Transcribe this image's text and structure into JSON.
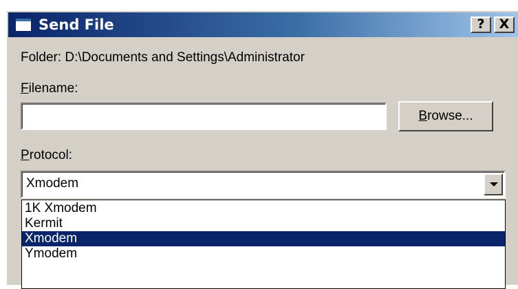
{
  "window": {
    "title": "Send File",
    "help_glyph": "?",
    "close_glyph": "X"
  },
  "folder": {
    "text": "Folder:  D:\\Documents and Settings\\Administrator"
  },
  "filename": {
    "label_mnemonic": "F",
    "label_rest": "ilename:",
    "value": ""
  },
  "browse_button": {
    "mnemonic": "B",
    "rest": "rowse..."
  },
  "protocol": {
    "label_mnemonic": "P",
    "label_rest": "rotocol:",
    "selected": "Xmodem",
    "options": [
      "1K Xmodem",
      "Kermit",
      "Xmodem",
      "Ymodem"
    ],
    "highlighted_index": 2
  },
  "icons": {
    "window_icon": "window-icon",
    "dropdown_arrow": "chevron-down-icon"
  },
  "colors": {
    "titlebar_start": "#0a246a",
    "titlebar_end": "#a6caf0",
    "selection": "#0a246a",
    "face": "#d4d0c8"
  }
}
